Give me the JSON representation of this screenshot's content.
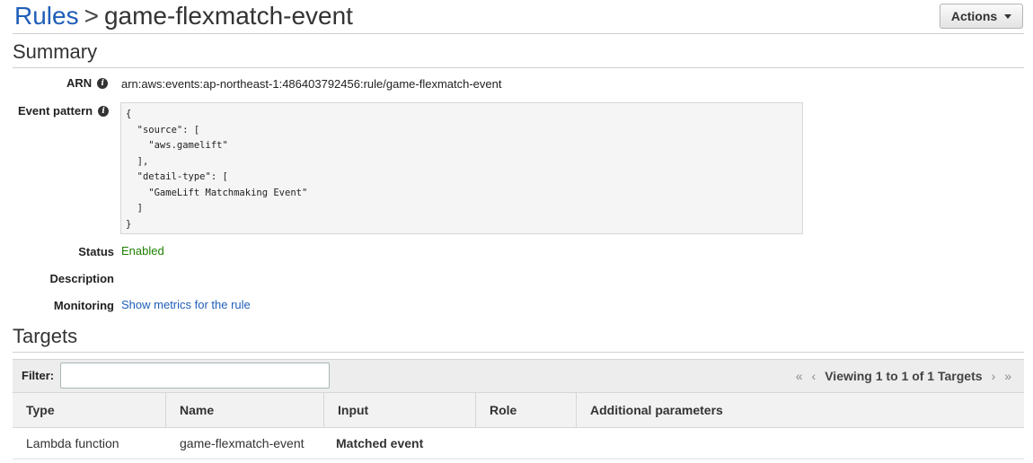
{
  "header": {
    "breadcrumb_root": "Rules",
    "breadcrumb_sep": ">",
    "title": "game-flexmatch-event",
    "actions_label": "Actions"
  },
  "summary": {
    "title": "Summary",
    "arn_label": "ARN",
    "arn_value": "arn:aws:events:ap-northeast-1:486403792456:rule/game-flexmatch-event",
    "event_pattern_label": "Event pattern",
    "event_pattern": "{\n  \"source\": [\n    \"aws.gamelift\"\n  ],\n  \"detail-type\": [\n    \"GameLift Matchmaking Event\"\n  ]\n}",
    "status_label": "Status",
    "status_value": "Enabled",
    "description_label": "Description",
    "description_value": "",
    "monitoring_label": "Monitoring",
    "monitoring_link": "Show metrics for the rule"
  },
  "targets": {
    "title": "Targets",
    "filter_label": "Filter:",
    "filter_value": "",
    "pager_text": "Viewing 1 to 1 of 1 Targets",
    "columns": [
      "Type",
      "Name",
      "Input",
      "Role",
      "Additional parameters"
    ],
    "rows": [
      {
        "type": "Lambda function",
        "name": "game-flexmatch-event",
        "input": "Matched event",
        "role": "",
        "additional": ""
      }
    ]
  },
  "colors": {
    "link": "#1f5eb8",
    "status_enabled": "#1d8102"
  },
  "icons": [
    "info-icon",
    "caret-down-icon",
    "first-page-icon",
    "prev-page-icon",
    "next-page-icon",
    "last-page-icon"
  ]
}
